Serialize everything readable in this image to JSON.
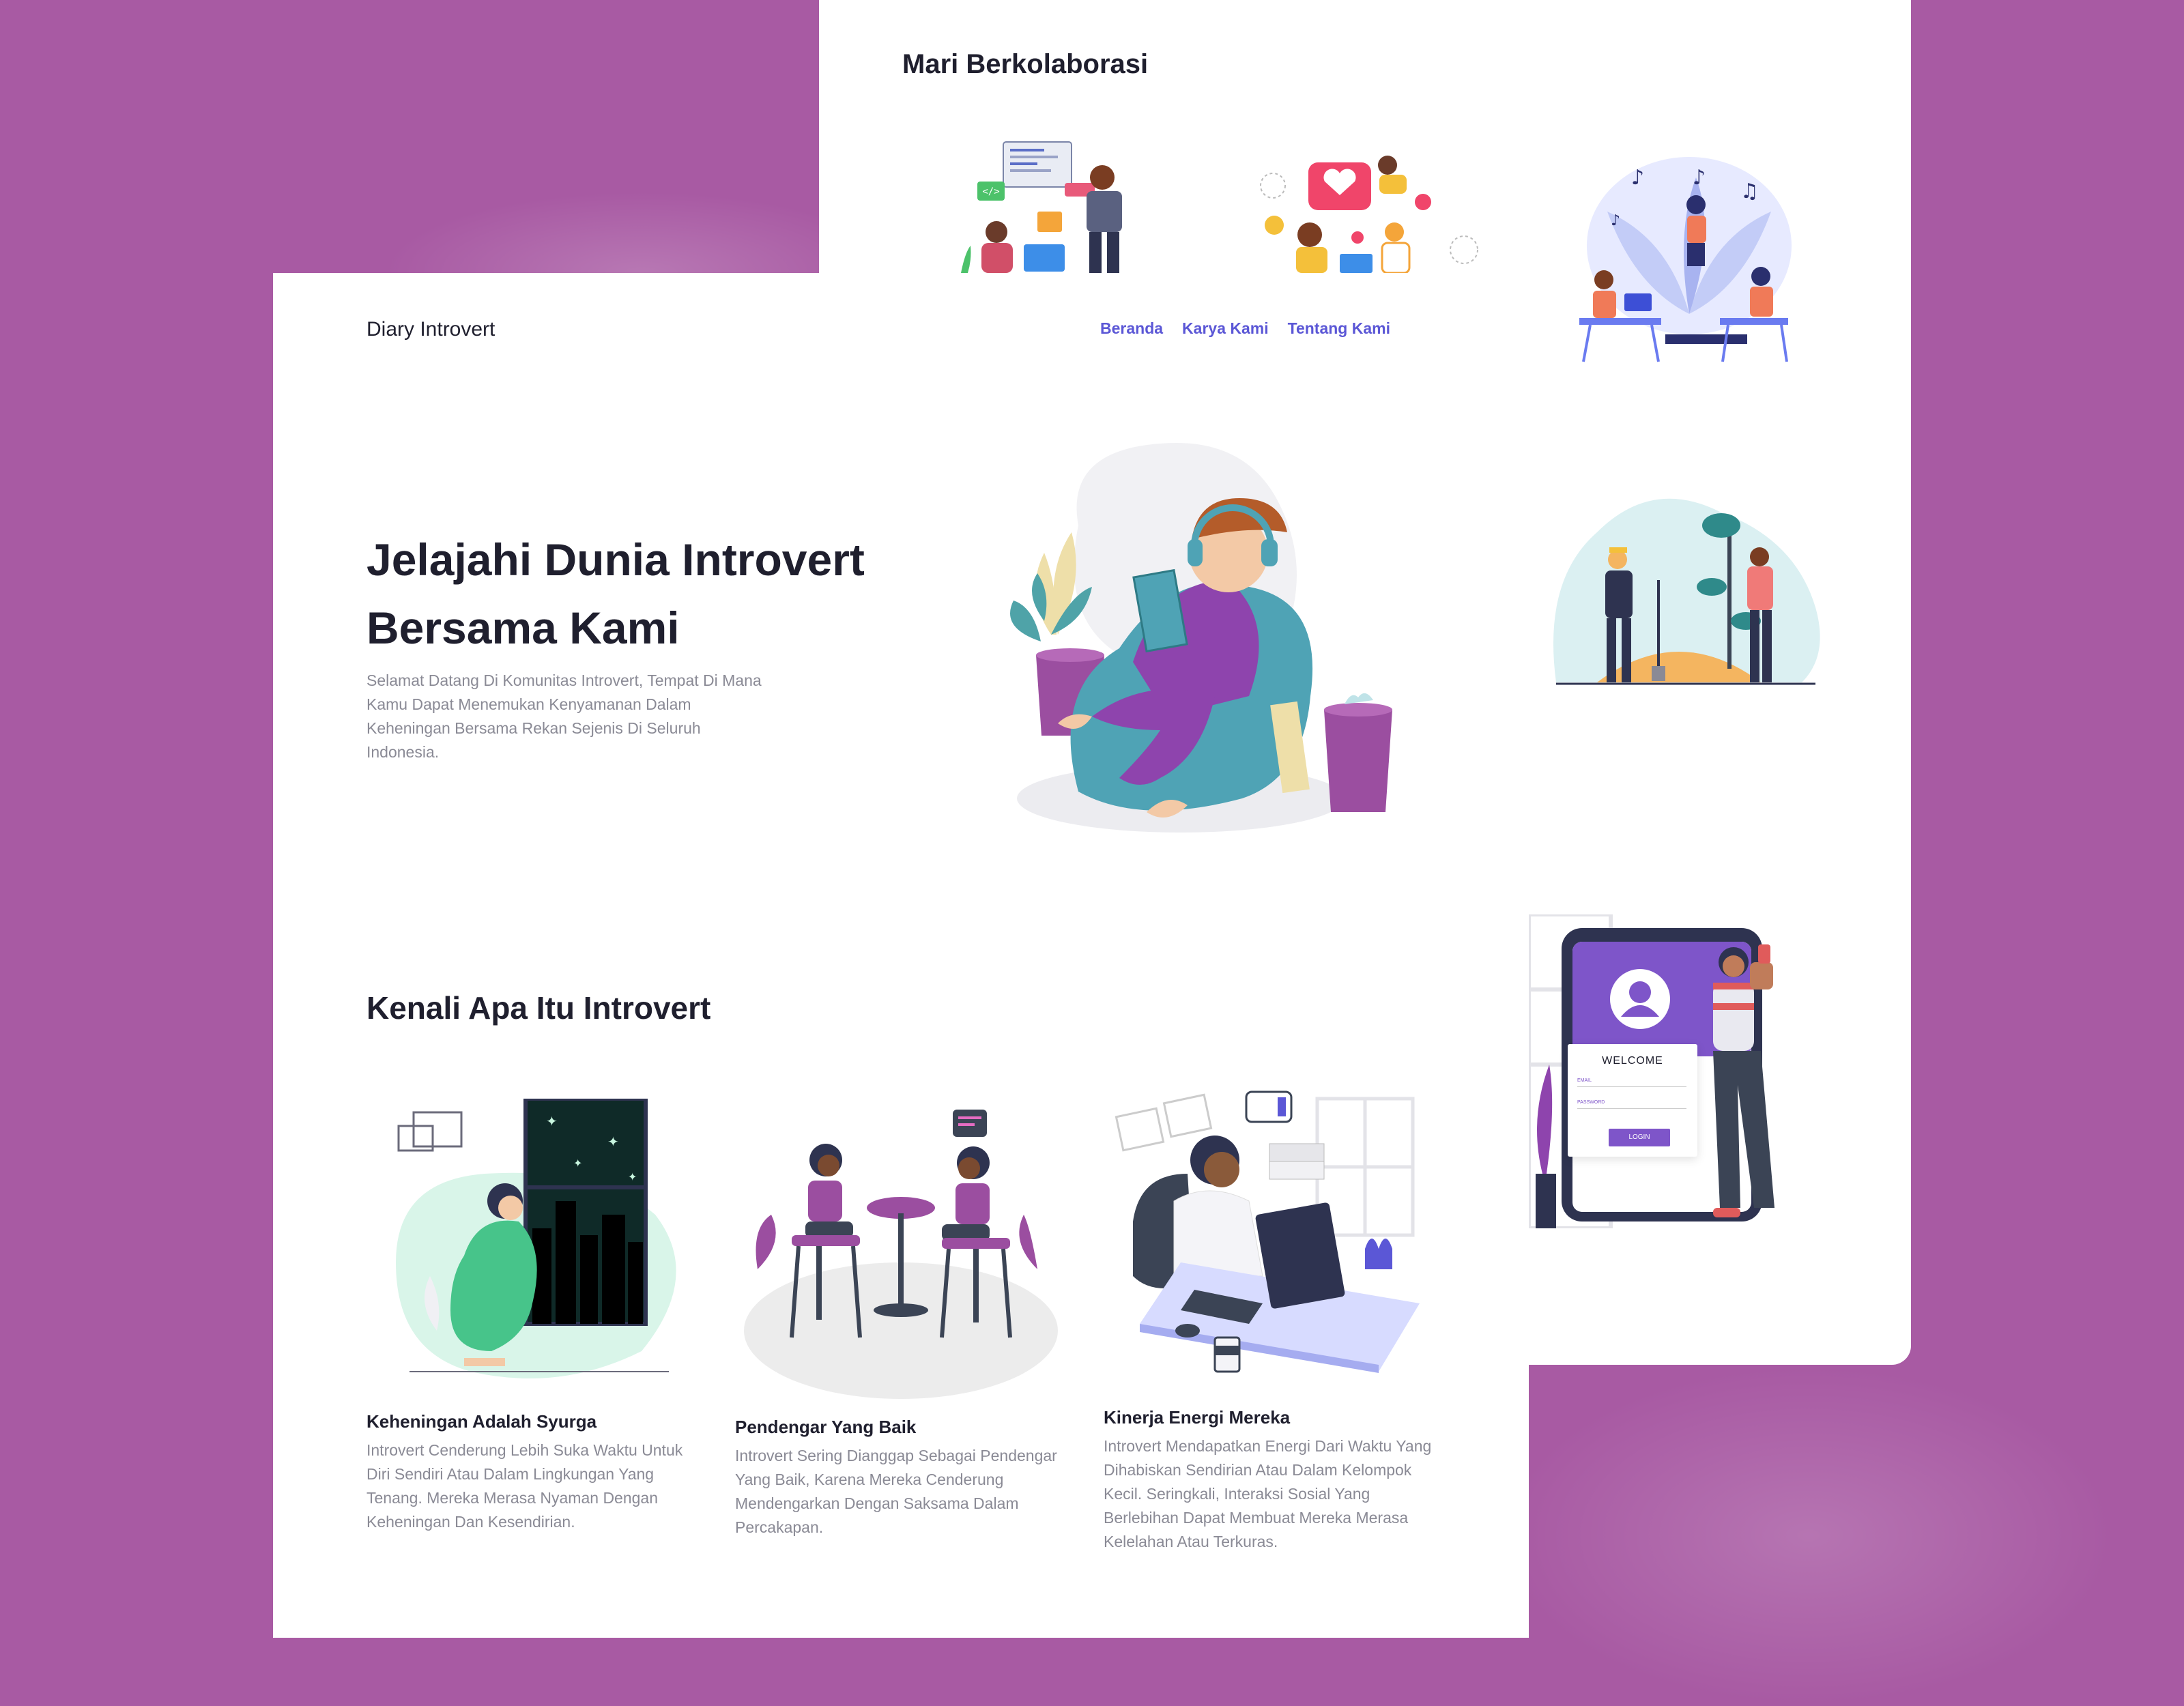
{
  "collab": {
    "title": "Mari Berkolaborasi"
  },
  "brand": "Diary Introvert",
  "nav": {
    "items": [
      {
        "label": "Beranda"
      },
      {
        "label": "Karya Kami"
      },
      {
        "label": "Tentang Kami"
      }
    ]
  },
  "hero": {
    "title_line1": "Jelajahi Dunia Introvert",
    "title_line2": "Bersama Kami",
    "description": "Selamat Datang Di Komunitas Introvert, Tempat Di Mana Kamu Dapat Menemukan Kenyamanan Dalam Keheningan Bersama Rekan Sejenis Di Seluruh Indonesia."
  },
  "section": {
    "title": "Kenali Apa Itu Introvert",
    "features": [
      {
        "title": "Keheningan Adalah Syurga",
        "description": "Introvert Cenderung Lebih Suka Waktu Untuk Diri Sendiri Atau Dalam Lingkungan Yang Tenang. Mereka Merasa Nyaman Dengan Keheningan Dan Kesendirian."
      },
      {
        "title": "Pendengar Yang Baik",
        "description": "Introvert Sering Dianggap Sebagai Pendengar Yang Baik, Karena Mereka Cenderung Mendengarkan Dengan Saksama Dalam Percakapan."
      },
      {
        "title": "Kinerja Energi Mereka",
        "description": "Introvert Mendapatkan Energi Dari Waktu Yang Dihabiskan Sendirian Atau Dalam Kelompok Kecil. Seringkali, Interaksi Sosial Yang Berlebihan Dapat Membuat Mereka Merasa Kelelahan Atau Terkuras."
      }
    ]
  },
  "phone": {
    "welcome": "WELCOME",
    "email_label": "EMAIL",
    "password_label": "PASSWORD",
    "login_label": "LOGIN"
  },
  "colors": {
    "background": "#a85aa3",
    "accent": "#5b57d6",
    "purple": "#8e44ad",
    "teal": "#4fa3b5"
  }
}
